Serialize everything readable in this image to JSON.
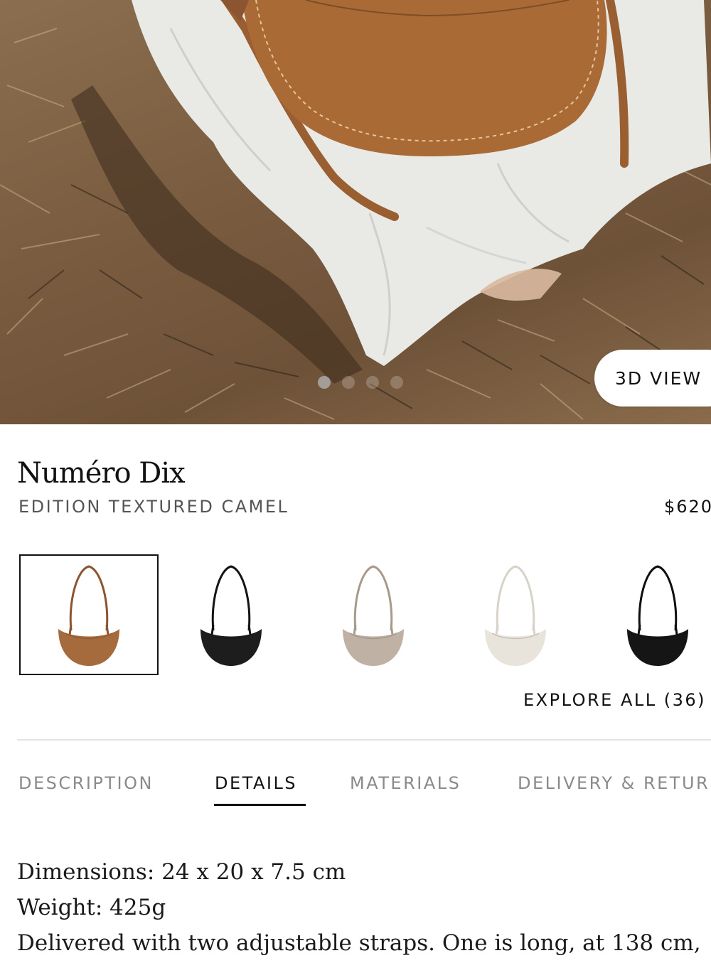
{
  "hero": {
    "carousel_dots": 4,
    "active_dot": 1,
    "view_3d_label": "3D VIEW"
  },
  "product": {
    "name": "Numéro Dix",
    "edition": "EDITION TEXTURED CAMEL",
    "price": "$620"
  },
  "swatches": [
    {
      "color_name": "camel",
      "body_color": "#a66b3d",
      "strap_color": "#8a5530",
      "selected": true
    },
    {
      "color_name": "black",
      "body_color": "#1d1d1d",
      "strap_color": "#141414",
      "selected": false
    },
    {
      "color_name": "taupe",
      "body_color": "#bfb2a4",
      "strap_color": "#a89a8b",
      "selected": false
    },
    {
      "color_name": "cream",
      "body_color": "#e8e4dc",
      "strap_color": "#d8d3c8",
      "selected": false
    },
    {
      "color_name": "black-suede",
      "body_color": "#151515",
      "strap_color": "#0f0f0f",
      "selected": false
    }
  ],
  "explore_all_label": "EXPLORE ALL (36)",
  "tabs": [
    {
      "label": "DESCRIPTION",
      "active": false
    },
    {
      "label": "DETAILS",
      "active": true
    },
    {
      "label": "MATERIALS",
      "active": false
    },
    {
      "label": "DELIVERY & RETURNS",
      "active": false
    }
  ],
  "details": {
    "line1": "Dimensions: 24 x 20 x 7.5 cm",
    "line2": "Weight: 425g",
    "line3": "Delivered with two adjustable straps. One is long, at 138 cm,"
  }
}
